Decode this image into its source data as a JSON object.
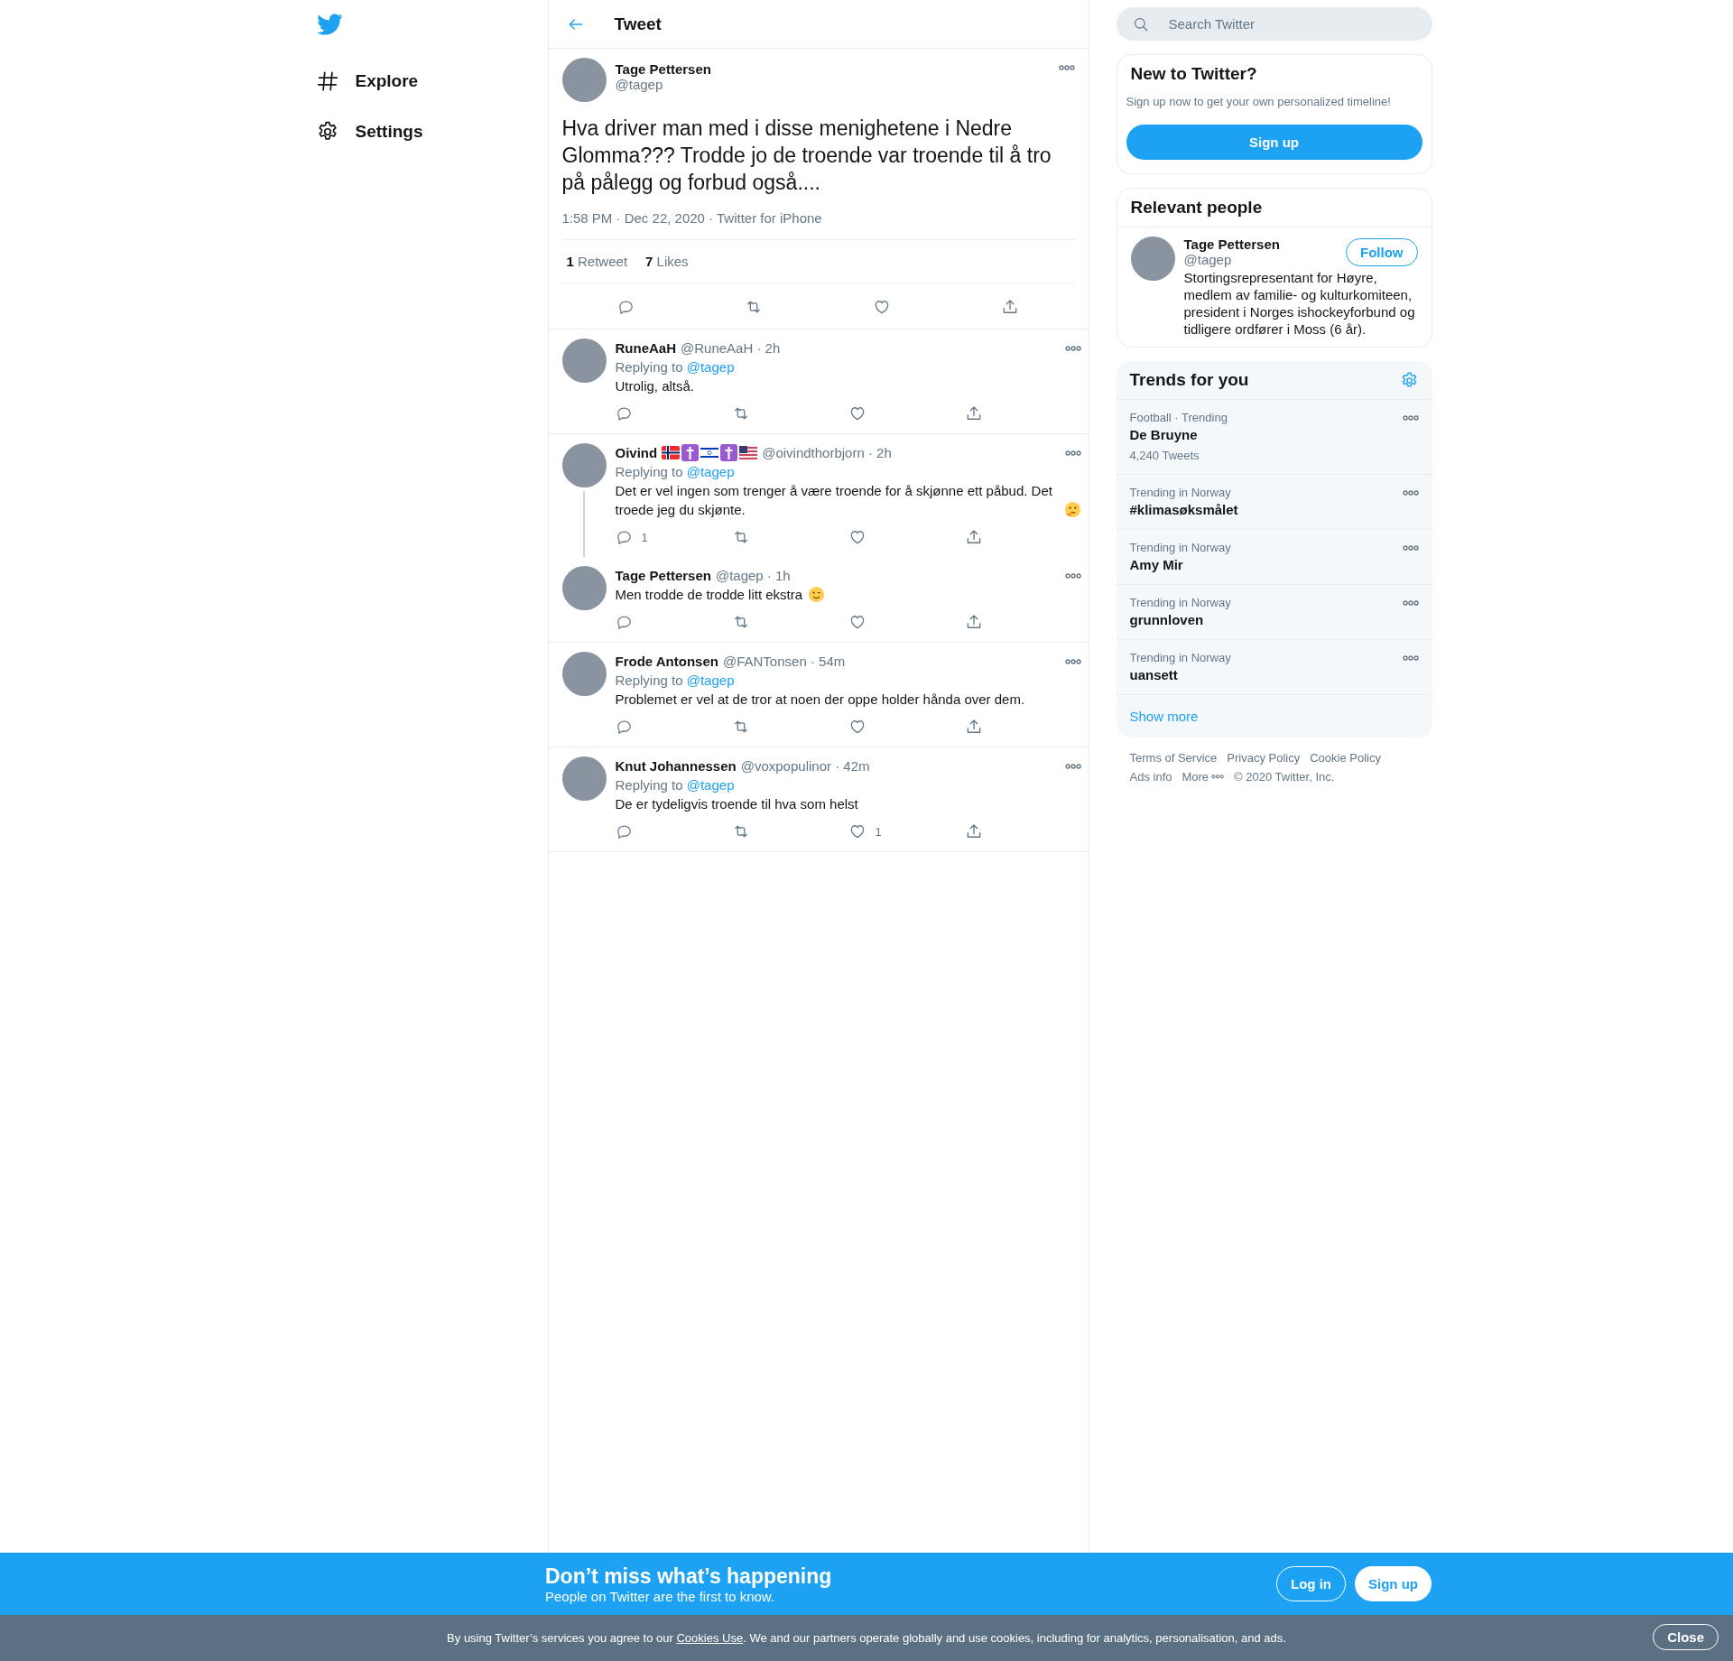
{
  "sidebar": {
    "items": [
      {
        "label": "Explore",
        "kind": "hash"
      },
      {
        "label": "Settings",
        "kind": "gear"
      }
    ]
  },
  "header": {
    "title": "Tweet"
  },
  "tweet": {
    "name": "Tage Pettersen",
    "handle": "@tagep",
    "text": "Hva driver man med i disse menighetene i Nedre Glomma??? Trodde jo de troende var troende til å tro på pålegg og forbud også....",
    "meta": "1:58 PM · Dec 22, 2020 · Twitter for iPhone",
    "stats": [
      {
        "count": "1",
        "label": "Retweet"
      },
      {
        "count": "7",
        "label": "Likes"
      }
    ]
  },
  "replies": [
    {
      "name": "RuneAaH",
      "handle_time": "@RuneAaH · 2h",
      "replying_label": "Replying to",
      "replying_to": "@tagep",
      "text": "Utrolig, altså.",
      "thread_continues": false
    },
    {
      "name": "Oivind",
      "badges": [
        {
          "kind": "norway-flag"
        },
        {
          "kind": "cross"
        },
        {
          "kind": "israel-flag"
        },
        {
          "kind": "cross"
        },
        {
          "kind": "us-flag"
        }
      ],
      "handle_time": "@oivindthorbjorn · 2h",
      "replying_label": "Replying to",
      "replying_to": "@tagep",
      "text": "Det er vel ingen som trenger å være troende for å skjønne ett påbud. Det troede jeg du skjønte.",
      "emoji": {
        "kind": "thinking"
      },
      "reply_count": "1",
      "thread_continues": true
    },
    {
      "name": "Tage Pettersen",
      "handle_time": "@tagep · 1h",
      "text": "Men trodde de trodde litt ekstra",
      "emoji": {
        "kind": "wink"
      },
      "thread_continues": false
    },
    {
      "name": "Frode Antonsen",
      "handle_time": "@FANTonsen · 54m",
      "replying_label": "Replying to",
      "replying_to": "@tagep",
      "text": "Problemet er vel at de tror at noen der oppe holder hånda over dem.",
      "thread_continues": false
    },
    {
      "name": "Knut Johannessen",
      "handle_time": "@voxpopulinor · 42m",
      "replying_label": "Replying to",
      "replying_to": "@tagep",
      "text": "De er tydeligvis troende til hva som helst",
      "like_count": "1",
      "thread_continues": false
    }
  ],
  "search": {
    "placeholder": "Search Twitter"
  },
  "signup_card": {
    "title": "New to Twitter?",
    "text": "Sign up now to get your own personalized timeline!",
    "button": "Sign up"
  },
  "relevant_people": {
    "title": "Relevant people",
    "people": [
      {
        "name": "Tage Pettersen",
        "handle": "@tagep",
        "bio": "Stortingsrepresentant for Høyre, medlem av familie- og kulturkomiteen, president i Norges ishockeyforbund og tidligere ordfører i Moss (6 år).",
        "button": "Follow"
      }
    ]
  },
  "trends": {
    "title": "Trends for you",
    "items": [
      {
        "context": "Football · Trending",
        "name": "De Bruyne",
        "count": "4,240 Tweets"
      },
      {
        "context": "Trending in Norway",
        "name": "#klimasøksmålet"
      },
      {
        "context": "Trending in Norway",
        "name": "Amy Mir"
      },
      {
        "context": "Trending in Norway",
        "name": "grunnloven"
      },
      {
        "context": "Trending in Norway",
        "name": "uansett"
      }
    ],
    "show_more": "Show more"
  },
  "footer": {
    "links": [
      {
        "label": "Terms of Service"
      },
      {
        "label": "Privacy Policy"
      },
      {
        "label": "Cookie Policy"
      },
      {
        "label": "Ads info"
      },
      {
        "label": "More",
        "kind": "more"
      }
    ],
    "copyright": "© 2020 Twitter, Inc."
  },
  "banner": {
    "title": "Don’t miss what’s happening",
    "text": "People on Twitter are the first to know.",
    "buttons": [
      {
        "label": "Log in",
        "kind": "outline"
      },
      {
        "label": "Sign up",
        "kind": "filled"
      }
    ]
  },
  "cookie_bar": {
    "before": "By using Twitter’s services you agree to our ",
    "link": "Cookies Use",
    "after": ". We and our partners operate globally and use cookies, including for analytics, personalisation, and ads.",
    "button": "Close"
  }
}
